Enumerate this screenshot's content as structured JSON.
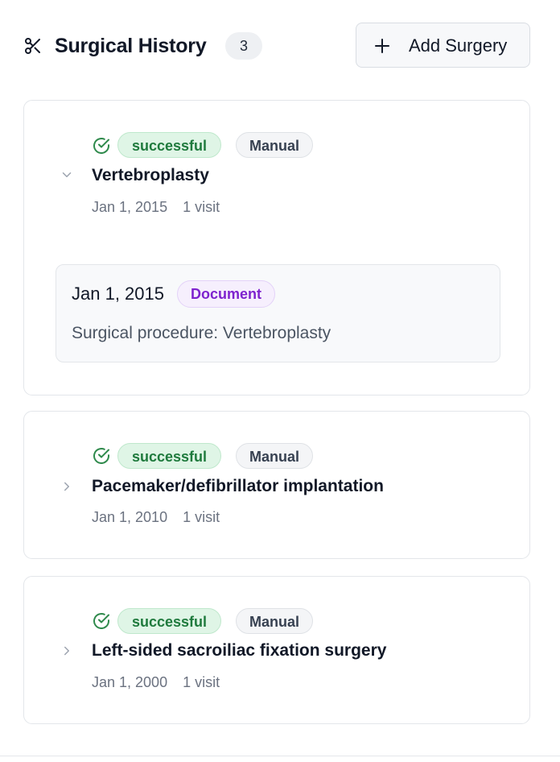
{
  "header": {
    "title": "Surgical History",
    "count": "3",
    "add_button_label": "Add Surgery"
  },
  "surgeries": [
    {
      "status": "successful",
      "source": "Manual",
      "name": "Vertebroplasty",
      "date": "Jan 1, 2015",
      "visits": "1 visit",
      "expanded": true,
      "records": [
        {
          "date": "Jan 1, 2015",
          "type": "Document",
          "description": "Surgical procedure: Vertebroplasty"
        }
      ]
    },
    {
      "status": "successful",
      "source": "Manual",
      "name": "Pacemaker/defibrillator implantation",
      "date": "Jan 1, 2010",
      "visits": "1 visit",
      "expanded": false
    },
    {
      "status": "successful",
      "source": "Manual",
      "name": "Left-sided sacroiliac fixation surgery",
      "date": "Jan 1, 2000",
      "visits": "1 visit",
      "expanded": false
    }
  ],
  "icons": {
    "header": "scissors-icon",
    "add": "plus-icon",
    "status": "check-circle-icon",
    "expanded": "chevron-down-icon",
    "collapsed": "chevron-right-icon"
  },
  "colors": {
    "success_bg": "#dff5e6",
    "success_text": "#1f7a3d",
    "document_text": "#7e22ce",
    "document_bg": "#f6effd"
  }
}
